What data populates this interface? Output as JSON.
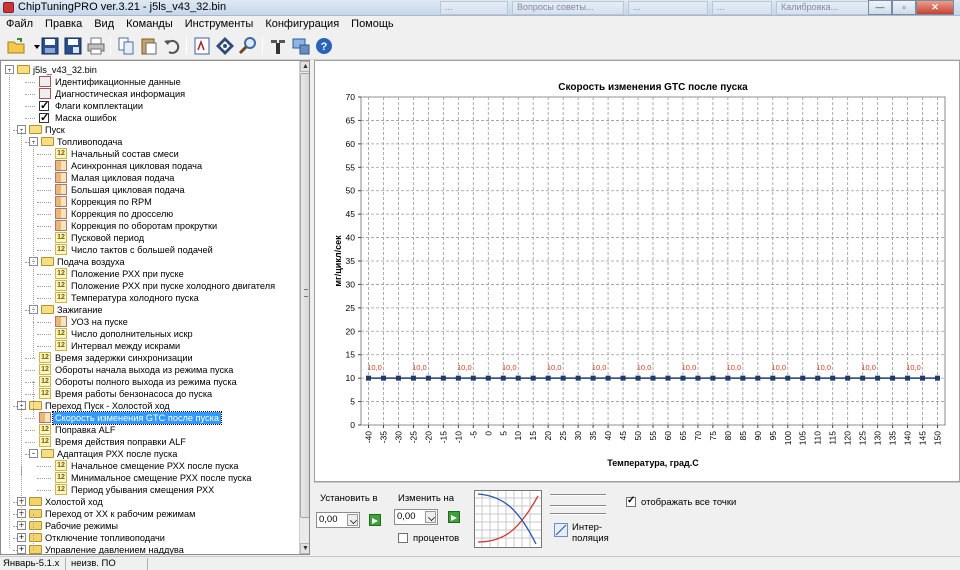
{
  "window": {
    "title": "ChipTuningPRO ver.3.21 - j5ls_v43_32.bin",
    "ghost_tabs": [
      "...",
      "Вопросы советы...",
      "...",
      "...",
      "Калибровка..."
    ]
  },
  "menu": [
    "Файл",
    "Правка",
    "Вид",
    "Команды",
    "Инструменты",
    "Конфигурация",
    "Помощь"
  ],
  "toolbar_icons": [
    "open-folder-icon",
    "dropdown-arrow-icon",
    "save-icon",
    "save-as-icon",
    "print-icon",
    "copy-icon",
    "paste-icon",
    "undo-icon",
    "bin-compare-icon",
    "checksum-icon",
    "search-icon",
    "tools-icon",
    "connect-icon",
    "help-icon"
  ],
  "tree": {
    "root": "j5ls_v43_32.bin",
    "rows": [
      {
        "label": "j5ls_v43_32.bin",
        "level": 0,
        "icon": "folder",
        "toggle": "-"
      },
      {
        "label": "Идентификационные данные",
        "level": 2,
        "icon": "doc"
      },
      {
        "label": "Диагностическая информация",
        "level": 2,
        "icon": "doc"
      },
      {
        "label": "Флаги комплектации",
        "level": 2,
        "icon": "check"
      },
      {
        "label": "Маска ошибок",
        "level": 2,
        "icon": "check"
      },
      {
        "label": "Пуск",
        "level": 1,
        "icon": "folder",
        "toggle": "-"
      },
      {
        "label": "Топливоподача",
        "level": 2,
        "icon": "folder",
        "toggle": "-"
      },
      {
        "label": "Начальный состав смеси",
        "level": 3,
        "icon": "i12"
      },
      {
        "label": "Асинхронная цикловая подача",
        "level": 3,
        "icon": "grid"
      },
      {
        "label": "Малая цикловая подача",
        "level": 3,
        "icon": "grid"
      },
      {
        "label": "Большая цикловая подача",
        "level": 3,
        "icon": "grid"
      },
      {
        "label": "Коррекция по RPM",
        "level": 3,
        "icon": "grid"
      },
      {
        "label": "Коррекция по дросселю",
        "level": 3,
        "icon": "grid"
      },
      {
        "label": "Коррекция по оборотам прокрутки",
        "level": 3,
        "icon": "grid"
      },
      {
        "label": "Пусковой период",
        "level": 3,
        "icon": "i12"
      },
      {
        "label": "Число тактов с большей подачей",
        "level": 3,
        "icon": "i12"
      },
      {
        "label": "Подача воздуха",
        "level": 2,
        "icon": "folder",
        "toggle": "-"
      },
      {
        "label": "Положение РХХ при пуске",
        "level": 3,
        "icon": "i12"
      },
      {
        "label": "Положение РХХ при пуске холодного двигателя",
        "level": 3,
        "icon": "i12"
      },
      {
        "label": "Температура холодного пуска",
        "level": 3,
        "icon": "i12"
      },
      {
        "label": "Зажигание",
        "level": 2,
        "icon": "folder",
        "toggle": "-"
      },
      {
        "label": "УОЗ на пуске",
        "level": 3,
        "icon": "grid"
      },
      {
        "label": "Число дополнительных искр",
        "level": 3,
        "icon": "i12"
      },
      {
        "label": "Интервал между искрами",
        "level": 3,
        "icon": "i12"
      },
      {
        "label": "Время задержки синхронизации",
        "level": 2,
        "icon": "i12"
      },
      {
        "label": "Обороты начала выхода из режима пуска",
        "level": 2,
        "icon": "i12"
      },
      {
        "label": "Обороты полного выхода из режима пуска",
        "level": 2,
        "icon": "i12"
      },
      {
        "label": "Время работы бензонасоса до пуска",
        "level": 2,
        "icon": "i12"
      },
      {
        "label": "Переход Пуск - Холостой ход",
        "level": 1,
        "icon": "folder",
        "toggle": "-"
      },
      {
        "label": "Скорость изменения GTC после пуска",
        "level": 2,
        "icon": "grid",
        "selected": true
      },
      {
        "label": "Поправка ALF",
        "level": 2,
        "icon": "i12"
      },
      {
        "label": "Время действия поправки ALF",
        "level": 2,
        "icon": "i12"
      },
      {
        "label": "Адаптация РХХ после пуска",
        "level": 2,
        "icon": "folder",
        "toggle": "-"
      },
      {
        "label": "Начальное смещение РХХ после пуска",
        "level": 3,
        "icon": "i12"
      },
      {
        "label": "Минимальное смещение РХХ после пуска",
        "level": 3,
        "icon": "i12"
      },
      {
        "label": "Период убывания смещения РХХ",
        "level": 3,
        "icon": "i12"
      },
      {
        "label": "Холостой ход",
        "level": 1,
        "icon": "folder",
        "toggle": "+"
      },
      {
        "label": "Переход от ХХ к рабочим режимам",
        "level": 1,
        "icon": "folder",
        "toggle": "+"
      },
      {
        "label": "Рабочие режимы",
        "level": 1,
        "icon": "folder",
        "toggle": "+"
      },
      {
        "label": "Отключение топливоподачи",
        "level": 1,
        "icon": "folder",
        "toggle": "+"
      },
      {
        "label": "Управление давлением наддува",
        "level": 1,
        "icon": "folder",
        "toggle": "+"
      }
    ]
  },
  "chart_data": {
    "type": "line",
    "title": "Скорость изменения GTC после пуска",
    "xlabel": "Температура, град.С",
    "ylabel": "мг/цикл/сек",
    "x": [
      -40,
      -35,
      -30,
      -25,
      -20,
      -15,
      -10,
      -5,
      0,
      5,
      10,
      15,
      20,
      25,
      30,
      35,
      40,
      45,
      50,
      55,
      60,
      65,
      70,
      75,
      80,
      85,
      90,
      95,
      100,
      105,
      110,
      115,
      120,
      125,
      130,
      135,
      140,
      145,
      150
    ],
    "series": [
      {
        "values": [
          10,
          10,
          10,
          10,
          10,
          10,
          10,
          10,
          10,
          10,
          10,
          10,
          10,
          10,
          10,
          10,
          10,
          10,
          10,
          10,
          10,
          10,
          10,
          10,
          10,
          10,
          10,
          10,
          10,
          10,
          10,
          10,
          10,
          10,
          10,
          10,
          10,
          10,
          10
        ]
      }
    ],
    "data_labels_shown_every": 3,
    "data_label_text": "10,0",
    "ylim": [
      0,
      70
    ],
    "yticks": [
      0,
      5,
      10,
      15,
      20,
      25,
      30,
      35,
      40,
      45,
      50,
      55,
      60,
      65,
      70
    ],
    "grid": true,
    "colors": {
      "line": "#1f3b6b",
      "marker": "#1f3b6b",
      "data_label": "#d0401f"
    }
  },
  "bottom": {
    "set_label": "Установить в",
    "set_value": "0,00",
    "change_label": "Изменить на",
    "change_value": "0,00",
    "percent_label": "процентов",
    "percent_checked": false,
    "interp_label_1": "Интер-",
    "interp_label_2": "поляция",
    "show_all_label": "отображать все точки",
    "show_all_checked": true
  },
  "status": {
    "version": "Январь-5.1.x",
    "software": "неизв. ПО"
  }
}
